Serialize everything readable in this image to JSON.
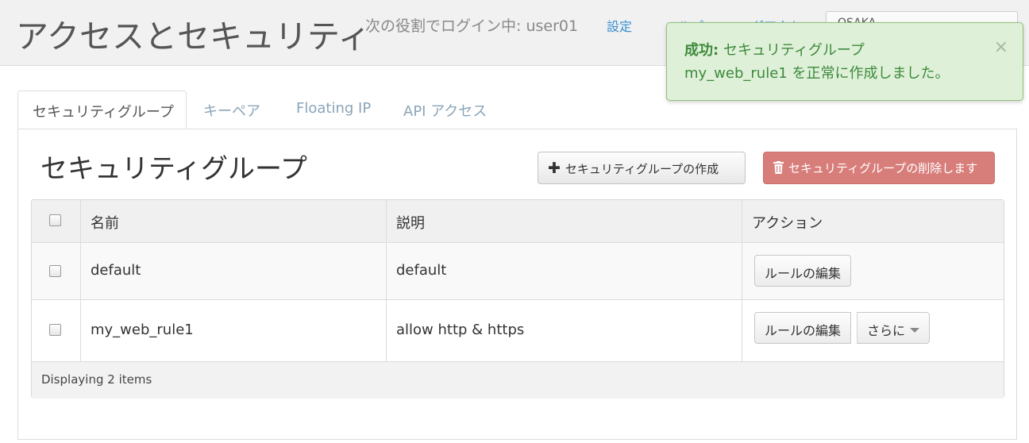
{
  "header": {
    "title": "アクセスとセキュリティ",
    "login_info": "次の役割でログイン中: user01",
    "links": {
      "settings": "設定",
      "help": "ヘルプ",
      "logout": "ログアウト"
    },
    "region": "OSAKA"
  },
  "toast": {
    "prefix": "成功:",
    "line1_rest": "セキュリティグループ",
    "name": "my_web_rule1",
    "suffix": "を正常に作成しました。",
    "close": "×"
  },
  "tabs": [
    {
      "label": "セキュリティグループ"
    },
    {
      "label": "キーペア"
    },
    {
      "label": "Floating IP"
    },
    {
      "label": "API アクセス"
    }
  ],
  "section": {
    "title": "セキュリティグループ",
    "create_button": "セキュリティグループの作成",
    "delete_button": "セキュリティグループの削除します"
  },
  "table": {
    "headers": {
      "name": "名前",
      "description": "説明",
      "actions": "アクション"
    },
    "rows": [
      {
        "name": "default",
        "description": "default",
        "action": "ルールの編集",
        "more": ""
      },
      {
        "name": "my_web_rule1",
        "description": "allow http & https",
        "action": "ルールの編集",
        "more": "さらに"
      }
    ],
    "footer": "Displaying 2 items"
  },
  "colors": {
    "accent_link": "#3a8fd0",
    "success_bg": "#dff0d8",
    "success_text": "#3c8a3c",
    "danger": "#d87e7a"
  }
}
